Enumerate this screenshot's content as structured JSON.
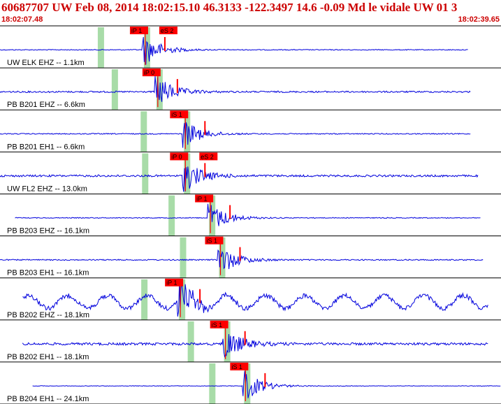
{
  "header": {
    "title": "60687707 UW Feb 08, 2014 18:02:15.10   46.3133 -122.3497 14.6 -0.09 Md le vidale UW 01   3",
    "start_time": "18:02:07.48",
    "end_time": "18:02:39.65"
  },
  "colors": {
    "trace": "#0000dd",
    "pick_box": "#ff0000",
    "pick_text": "#000000",
    "header_text": "#cc0000",
    "window": "#a8dca8",
    "grid": "#000000"
  },
  "chart_data": {
    "type": "line",
    "title": "60687707 UW Feb 08, 2014 18:02:15.10   46.3133 -122.3497 14.6 -0.09 Md le vidale UW 01   3",
    "x_range": [
      "18:02:07.48",
      "18:02:39.65"
    ],
    "channels": [
      {
        "label": "UW ELK EHZ -- 1.1km",
        "picks": [
          "iP 1",
          "eS 2"
        ],
        "trace_start": 0.0,
        "trace_end": 0.935,
        "noise": 0.18,
        "event": 0.29,
        "amp": 1.0
      },
      {
        "label": "PB B201 EHZ -- 6.6km",
        "picks": [
          "iP 0"
        ],
        "trace_start": 0.0,
        "trace_end": 0.94,
        "noise": 0.35,
        "event": 0.315,
        "amp": 1.0
      },
      {
        "label": "PB B201 EH1 -- 6.6km",
        "picks": [
          "iS 1"
        ],
        "trace_start": 0.0,
        "trace_end": 0.94,
        "noise": 0.22,
        "event": 0.37,
        "amp": 0.9
      },
      {
        "label": "UW FL2 EHZ -- 13.0km",
        "picks": [
          "iP 0",
          "eS 2"
        ],
        "trace_start": 0.0,
        "trace_end": 0.955,
        "noise": 0.45,
        "event": 0.37,
        "amp": 1.0
      },
      {
        "label": "PB B203 EHZ -- 16.1km",
        "picks": [
          "iP 1"
        ],
        "trace_start": 0.03,
        "trace_end": 0.96,
        "noise": 0.18,
        "event": 0.42,
        "amp": 1.0
      },
      {
        "label": "PB B203 EH1 -- 16.1km",
        "picks": [
          "iS 1"
        ],
        "trace_start": 0.0,
        "trace_end": 0.965,
        "noise": 0.25,
        "event": 0.44,
        "amp": 1.0
      },
      {
        "label": "PB B202 EHZ -- 18.1km",
        "picks": [
          "iP 1"
        ],
        "trace_start": 0.045,
        "trace_end": 0.975,
        "noise": 1.0,
        "event": 0.36,
        "amp": 1.0
      },
      {
        "label": "PB B202 EH1 -- 18.1km",
        "picks": [
          "iS 1"
        ],
        "trace_start": 0.045,
        "trace_end": 0.975,
        "noise": 0.55,
        "event": 0.45,
        "amp": 1.0
      },
      {
        "label": "PB B204 EH1 -- 24.1km",
        "picks": [
          "iS 1"
        ],
        "trace_start": 0.065,
        "trace_end": 1.0,
        "noise": 0.12,
        "event": 0.49,
        "amp": 1.0
      }
    ]
  }
}
